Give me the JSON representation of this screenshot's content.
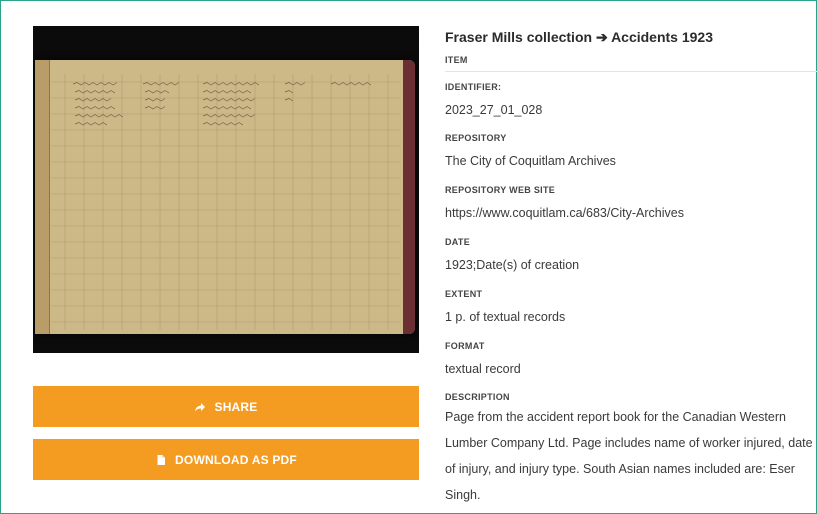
{
  "record": {
    "title_prefix": "Fraser Mills collection",
    "title_arrow": "➔",
    "title_suffix": "Accidents 1923",
    "item_label": "ITEM"
  },
  "fields": [
    {
      "label": "IDENTIFIER:",
      "value": "2023_27_01_028"
    },
    {
      "label": "REPOSITORY",
      "value": "The City of Coquitlam Archives"
    },
    {
      "label": "REPOSITORY WEB SITE",
      "value": "https://www.coquitlam.ca/683/City-Archives"
    },
    {
      "label": "DATE",
      "value": "1923;Date(s) of creation"
    },
    {
      "label": "EXTENT",
      "value": "1 p. of textual records"
    },
    {
      "label": "FORMAT",
      "value": "textual record"
    }
  ],
  "description": {
    "label": "DESCRIPTION",
    "value": "Page from the accident report book for the Canadian Western Lumber Company Ltd. Page includes name of worker injured, date of injury, and injury type. South Asian names included are: Eser Singh."
  },
  "actions": {
    "share_label": "SHARE",
    "download_label": "DOWNLOAD AS PDF"
  },
  "image": {
    "alt": "Ledger page",
    "page_color": "#cdb887",
    "spine_color": "#6b2f33",
    "background": "#0b0b0b"
  },
  "colors": {
    "accent": "#f39c21",
    "border": "#2aa38a"
  },
  "icons": {
    "share": "share-arrow-icon",
    "download": "file-icon"
  }
}
